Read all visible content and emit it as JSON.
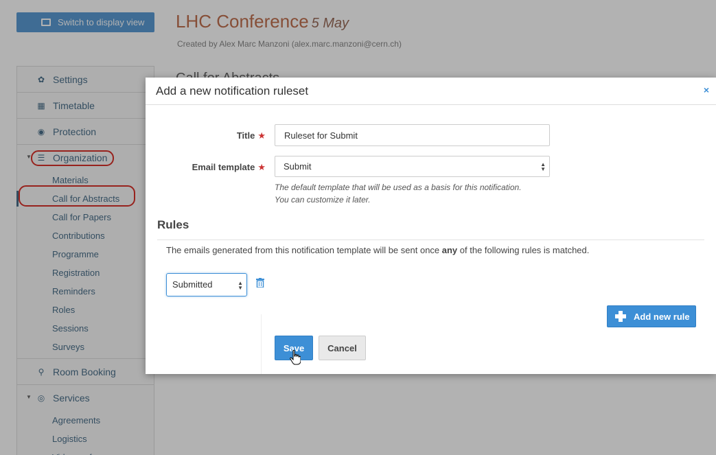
{
  "toolbar": {
    "display_view_label": "Switch to display view"
  },
  "event": {
    "title": "LHC Conference",
    "date": "5 May",
    "created_by": "Created by Alex Marc Manzoni (alex.marc.manzoni@cern.ch)",
    "section_heading": "Call for Abstracts"
  },
  "sidebar": {
    "items": [
      {
        "label": "Settings",
        "icon": "gear-icon"
      },
      {
        "label": "Timetable",
        "icon": "calendar-icon"
      },
      {
        "label": "Protection",
        "icon": "shield-icon"
      },
      {
        "label": "Organization",
        "icon": "list-icon"
      }
    ],
    "organization_sub": [
      "Materials",
      "Call for Abstracts",
      "Call for Papers",
      "Contributions",
      "Programme",
      "Registration",
      "Reminders",
      "Roles",
      "Sessions",
      "Surveys"
    ],
    "room_booking": {
      "label": "Room Booking",
      "icon": "map-pin-icon"
    },
    "services": {
      "label": "Services",
      "icon": "broadcast-icon"
    },
    "services_sub": [
      "Agreements",
      "Logistics",
      "Videoconference"
    ]
  },
  "modal": {
    "title": "Add a new notification ruleset",
    "close": "×",
    "title_label": "Title",
    "title_value": "Ruleset for Submit",
    "template_label": "Email template",
    "template_value": "Submit",
    "help_line1": "The default template that will be used as a basis for this notification.",
    "help_line2": "You can customize it later.",
    "rules_heading": "Rules",
    "rules_desc_before": "The emails generated from this notification template will be sent once ",
    "rules_desc_bold": "any",
    "rules_desc_after": " of the following rules is matched.",
    "rule_value": "Submitted",
    "add_rule_label": "Add new rule",
    "save_label": "Save",
    "cancel_label": "Cancel",
    "required_mark": "★"
  },
  "colors": {
    "accent": "#3d8fd6",
    "highlight": "#d9312a",
    "title": "#c0704f"
  }
}
